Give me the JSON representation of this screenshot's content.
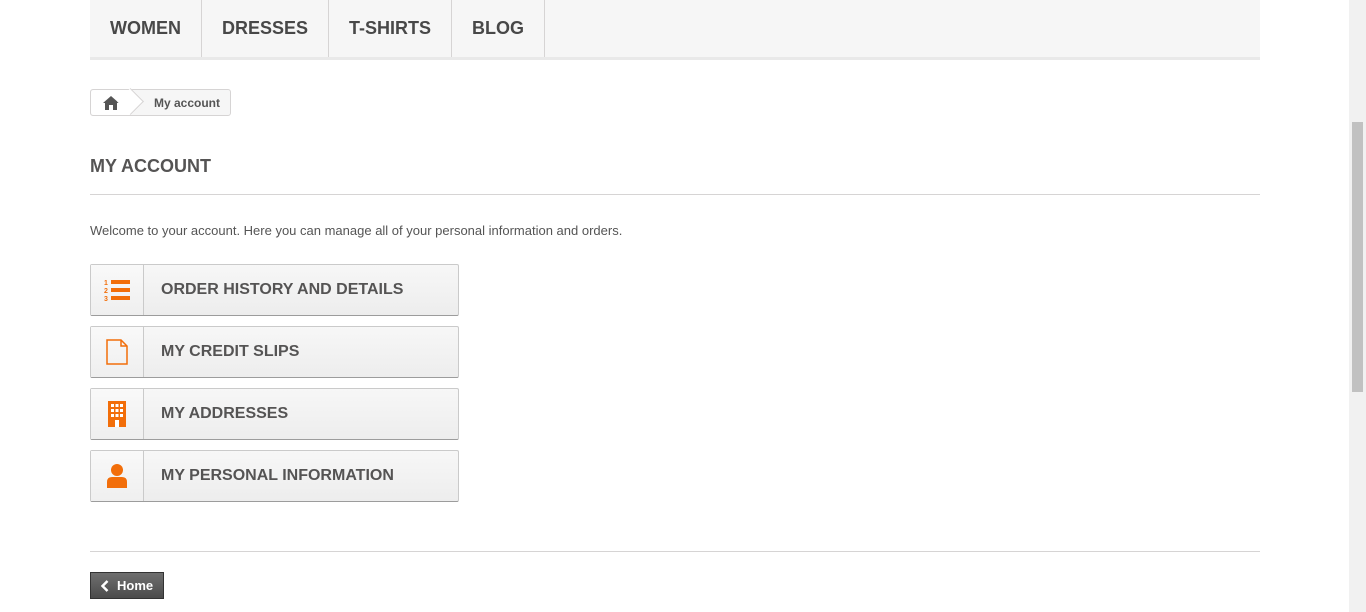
{
  "nav": {
    "items": [
      {
        "label": "WOMEN"
      },
      {
        "label": "DRESSES"
      },
      {
        "label": "T-SHIRTS"
      },
      {
        "label": "BLOG"
      }
    ]
  },
  "breadcrumb": {
    "home_icon": "home-icon",
    "current": "My account"
  },
  "main": {
    "title": "MY ACCOUNT",
    "welcome": "Welcome to your account. Here you can manage all of your personal information and orders.",
    "links": [
      {
        "label": "ORDER HISTORY AND DETAILS",
        "icon": "ordered-list-icon"
      },
      {
        "label": "MY CREDIT SLIPS",
        "icon": "document-icon"
      },
      {
        "label": "MY ADDRESSES",
        "icon": "building-icon"
      },
      {
        "label": "MY PERSONAL INFORMATION",
        "icon": "user-icon"
      }
    ]
  },
  "footer": {
    "home_button_label": "Home"
  },
  "colors": {
    "accent": "#f26e0a",
    "dark_button": "#5a5a5a"
  }
}
